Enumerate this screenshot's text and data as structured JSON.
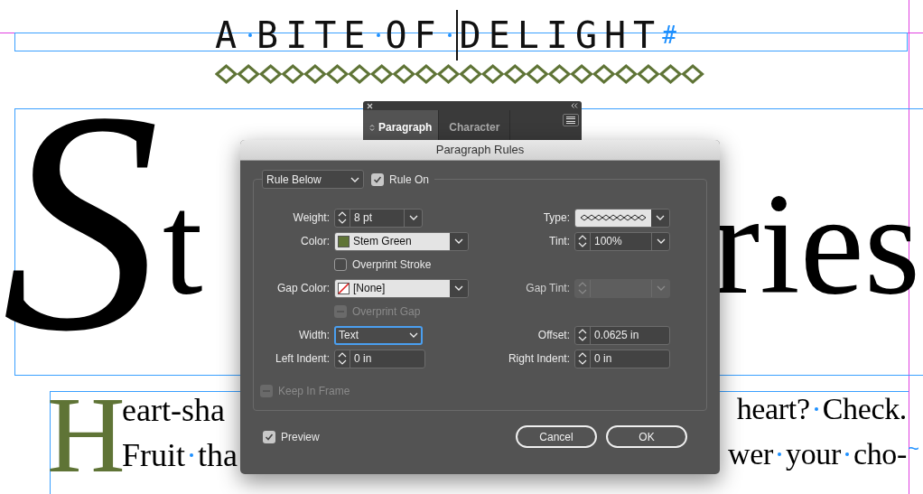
{
  "document": {
    "heading_words": [
      {
        "text": "A",
        "cursor_before": false
      },
      {
        "text": "BITE",
        "cursor_before": false
      },
      {
        "text": "OF",
        "cursor_before": false
      },
      {
        "text": "DELIGHT",
        "cursor_before": true
      }
    ],
    "heading_end_mark": "#",
    "title_drop": "S",
    "title_left": "t",
    "title_right": "ries",
    "body_drop": "H",
    "body_lines": [
      {
        "left": [
          "eart-sha"
        ],
        "right": [
          "heart?",
          "Check."
        ]
      },
      {
        "left": [
          "Fruit",
          "tha"
        ],
        "right": [
          "wer",
          "your",
          "cho-"
        ],
        "end_mark": "~"
      }
    ]
  },
  "panel": {
    "tabs": [
      {
        "label": "Paragraph",
        "selected": true
      },
      {
        "label": "Character",
        "selected": false
      }
    ]
  },
  "dialog": {
    "title": "Paragraph Rules",
    "rule_select": {
      "value": "Rule Below"
    },
    "rule_on": {
      "label": "Rule On",
      "checked": true
    },
    "rows": [
      [
        {
          "kind": "spin_select",
          "label": "Weight:",
          "value": "8 pt"
        },
        {
          "kind": "stroke_select",
          "label": "Type:"
        }
      ],
      [
        {
          "kind": "swatch_select",
          "label": "Color:",
          "value": "Stem Green",
          "color": "#5f7436"
        },
        {
          "kind": "spin_select",
          "label": "Tint:",
          "value": "100%"
        }
      ],
      [
        {
          "kind": "checkbox",
          "label": "Overprint Stroke",
          "checked": false,
          "disabled": false
        }
      ],
      [
        {
          "kind": "swatch_select",
          "label": "Gap Color:",
          "value": "[None]"
        },
        {
          "kind": "spin_select",
          "label": "Gap Tint:",
          "disabled": true
        }
      ],
      [
        {
          "kind": "checkbox",
          "label": "Overprint Gap",
          "checked": false,
          "disabled": true
        }
      ],
      [
        {
          "kind": "select",
          "label": "Width:",
          "value": "Text",
          "focused": true
        },
        {
          "kind": "spin",
          "label": "Offset:",
          "value": "0.0625 in"
        }
      ],
      [
        {
          "kind": "spin",
          "label": "Left Indent:",
          "value": "0 in"
        },
        {
          "kind": "spin",
          "label": "Right Indent:",
          "value": "0 in"
        }
      ]
    ],
    "keep_in_frame": {
      "label": "Keep In Frame",
      "checked": false,
      "disabled": true
    },
    "preview": {
      "label": "Preview",
      "checked": true
    },
    "buttons": [
      "Cancel",
      "OK"
    ]
  }
}
